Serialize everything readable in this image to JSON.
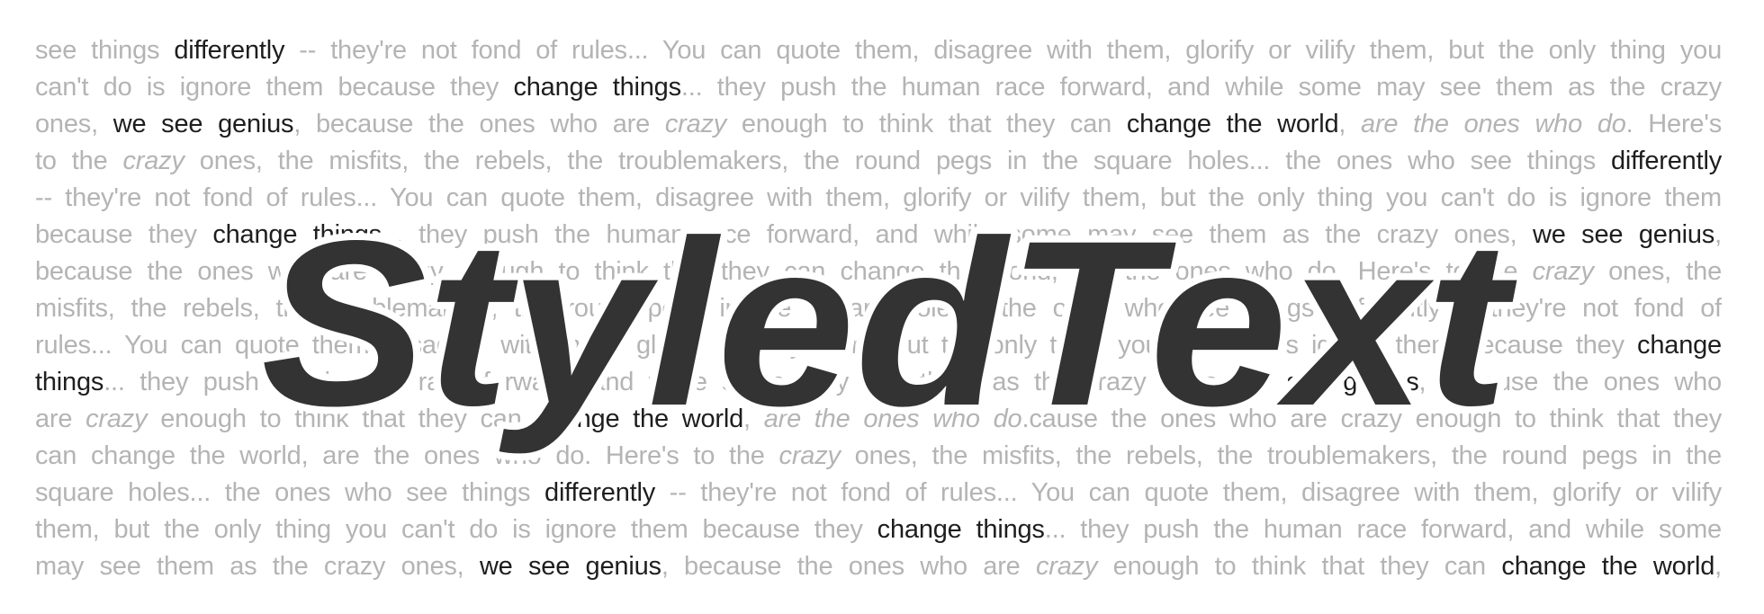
{
  "lines": [
    [
      {
        "t": "see things ",
        "s": "n"
      },
      {
        "t": "differently",
        "s": "e"
      },
      {
        "t": " -- they're not fond of rules... You can quote them, disagree with them, glorify or vilify them, but the only thing you",
        "s": "n"
      }
    ],
    [
      {
        "t": "can't do is ignore them because they ",
        "s": "n"
      },
      {
        "t": "change things",
        "s": "e"
      },
      {
        "t": "... they push the human race forward, and while some may see them as the crazy",
        "s": "n"
      }
    ],
    [
      {
        "t": "ones, ",
        "s": "n"
      },
      {
        "t": "we see genius",
        "s": "e"
      },
      {
        "t": ", because the ones who are ",
        "s": "n"
      },
      {
        "t": "crazy",
        "s": "i"
      },
      {
        "t": " enough to think that they can ",
        "s": "n"
      },
      {
        "t": "change the world",
        "s": "e"
      },
      {
        "t": ", ",
        "s": "n"
      },
      {
        "t": "are the ones who do",
        "s": "i"
      },
      {
        "t": ". Here's",
        "s": "n"
      }
    ],
    [
      {
        "t": "to the ",
        "s": "n"
      },
      {
        "t": "crazy",
        "s": "i"
      },
      {
        "t": " ones, the misfits, the rebels, the troublemakers, the round pegs in the square holes... the ones who see things ",
        "s": "n"
      },
      {
        "t": "differently",
        "s": "e"
      }
    ],
    [
      {
        "t": "-- they're not fond of rules... You can quote them, disagree with them, glorify or vilify them, but the only thing you can't do is ignore them",
        "s": "n"
      }
    ],
    [
      {
        "t": "because they ",
        "s": "n"
      },
      {
        "t": "change things",
        "s": "e"
      },
      {
        "t": "... they push the human race forward, and while some may see them as the crazy ones, ",
        "s": "n"
      },
      {
        "t": "we see genius",
        "s": "e"
      },
      {
        "t": ",",
        "s": "n"
      }
    ],
    [
      {
        "t": "because the ones who are crazy enough to think that they can change the world, are the ones who do. Here's to the ",
        "s": "n"
      },
      {
        "t": "crazy",
        "s": "i"
      },
      {
        "t": " ones, the",
        "s": "n"
      }
    ],
    [
      {
        "t": "misfits, the rebels, the troublemakers, the round pegs in the square holes... the ones who see things differently -- they're not fond of",
        "s": "n"
      }
    ],
    [
      {
        "t": "rules... You can quote them, disagree with them, glorify or vilify them, but the only thing you can't do is ignore them because they ",
        "s": "n"
      },
      {
        "t": "change",
        "s": "e"
      }
    ],
    [
      {
        "t": "things",
        "s": "e"
      },
      {
        "t": "... they push the human race forward, and while some may see them as the crazy ones, ",
        "s": "n"
      },
      {
        "t": "we see genius",
        "s": "e"
      },
      {
        "t": ", because the ones who",
        "s": "n"
      }
    ],
    [
      {
        "t": "are ",
        "s": "n"
      },
      {
        "t": "crazy",
        "s": "i"
      },
      {
        "t": " enough to think that they can ",
        "s": "n"
      },
      {
        "t": "change the world",
        "s": "e"
      },
      {
        "t": ", ",
        "s": "n"
      },
      {
        "t": "are the ones who do",
        "s": "i"
      },
      {
        "t": ".cause the ones who are crazy enough to think that they",
        "s": "n"
      }
    ],
    [
      {
        "t": "can change the world, are the ones who do. Here's to the ",
        "s": "n"
      },
      {
        "t": "crazy",
        "s": "i"
      },
      {
        "t": " ones, the misfits, the rebels, the troublemakers, the round pegs in the",
        "s": "n"
      }
    ],
    [
      {
        "t": "square holes... the ones who see things ",
        "s": "n"
      },
      {
        "t": "differently",
        "s": "e"
      },
      {
        "t": " -- they're not fond of rules... You can quote them, disagree with them, glorify or vilify",
        "s": "n"
      }
    ],
    [
      {
        "t": "them, but the only thing you can't do is ignore them because they ",
        "s": "n"
      },
      {
        "t": "change things",
        "s": "e"
      },
      {
        "t": "... they push the human race forward, and while some",
        "s": "n"
      }
    ],
    [
      {
        "t": "may see them as the crazy ones, ",
        "s": "n"
      },
      {
        "t": "we see genius",
        "s": "e"
      },
      {
        "t": ", because the ones who are ",
        "s": "n"
      },
      {
        "t": "crazy",
        "s": "i"
      },
      {
        "t": " enough to think that they can ",
        "s": "n"
      },
      {
        "t": "change the world",
        "s": "e"
      },
      {
        "t": ",",
        "s": "n"
      }
    ]
  ],
  "headline": {
    "text": "StyledText"
  },
  "colors": {
    "background": "#ffffff",
    "body_text": "#b4b4b4",
    "emphasis_text": "#1e1e1e",
    "headline_fill": "#333333",
    "headline_outline": "#ffffff"
  }
}
